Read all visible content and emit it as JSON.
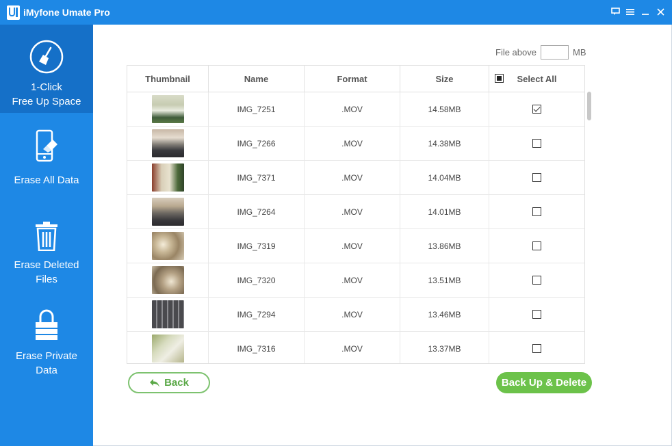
{
  "app": {
    "title": "iMyfone Umate Pro",
    "logo_icon": "umate-logo-icon",
    "window_controls": [
      "feedback-icon",
      "menu-icon",
      "minimize-icon",
      "close-icon"
    ]
  },
  "colors": {
    "brand_blue": "#1e88e5",
    "sidebar_active": "#1570c8",
    "green_accent": "#6cc24a"
  },
  "sidebar": {
    "items": [
      {
        "label_line1": "1-Click",
        "label_line2": "Free Up Space",
        "icon": "broom-icon",
        "active": true
      },
      {
        "label_line1": "Erase All Data",
        "label_line2": "",
        "icon": "phone-erase-icon",
        "active": false
      },
      {
        "label_line1": "Erase Deleted",
        "label_line2": "Files",
        "icon": "trash-icon",
        "active": false
      },
      {
        "label_line1": "Erase Private",
        "label_line2": "Data",
        "icon": "lock-icon",
        "active": false
      }
    ]
  },
  "filter": {
    "label": "File above",
    "value": "",
    "unit": "MB"
  },
  "table": {
    "columns": [
      "Thumbnail",
      "Name",
      "Format",
      "Size",
      "Select All"
    ],
    "select_all_state": "partial",
    "rows": [
      {
        "name": "IMG_7251",
        "format": ".MOV",
        "size": "14.58MB",
        "checked": true
      },
      {
        "name": "IMG_7266",
        "format": ".MOV",
        "size": "14.38MB",
        "checked": false
      },
      {
        "name": "IMG_7371",
        "format": ".MOV",
        "size": "14.04MB",
        "checked": false
      },
      {
        "name": "IMG_7264",
        "format": ".MOV",
        "size": "14.01MB",
        "checked": false
      },
      {
        "name": "IMG_7319",
        "format": ".MOV",
        "size": "13.86MB",
        "checked": false
      },
      {
        "name": "IMG_7320",
        "format": ".MOV",
        "size": "13.51MB",
        "checked": false
      },
      {
        "name": "IMG_7294",
        "format": ".MOV",
        "size": "13.46MB",
        "checked": false
      },
      {
        "name": "IMG_7316",
        "format": ".MOV",
        "size": "13.37MB",
        "checked": false
      }
    ]
  },
  "actions": {
    "back_label": "Back",
    "backup_label": "Back Up & Delete"
  }
}
